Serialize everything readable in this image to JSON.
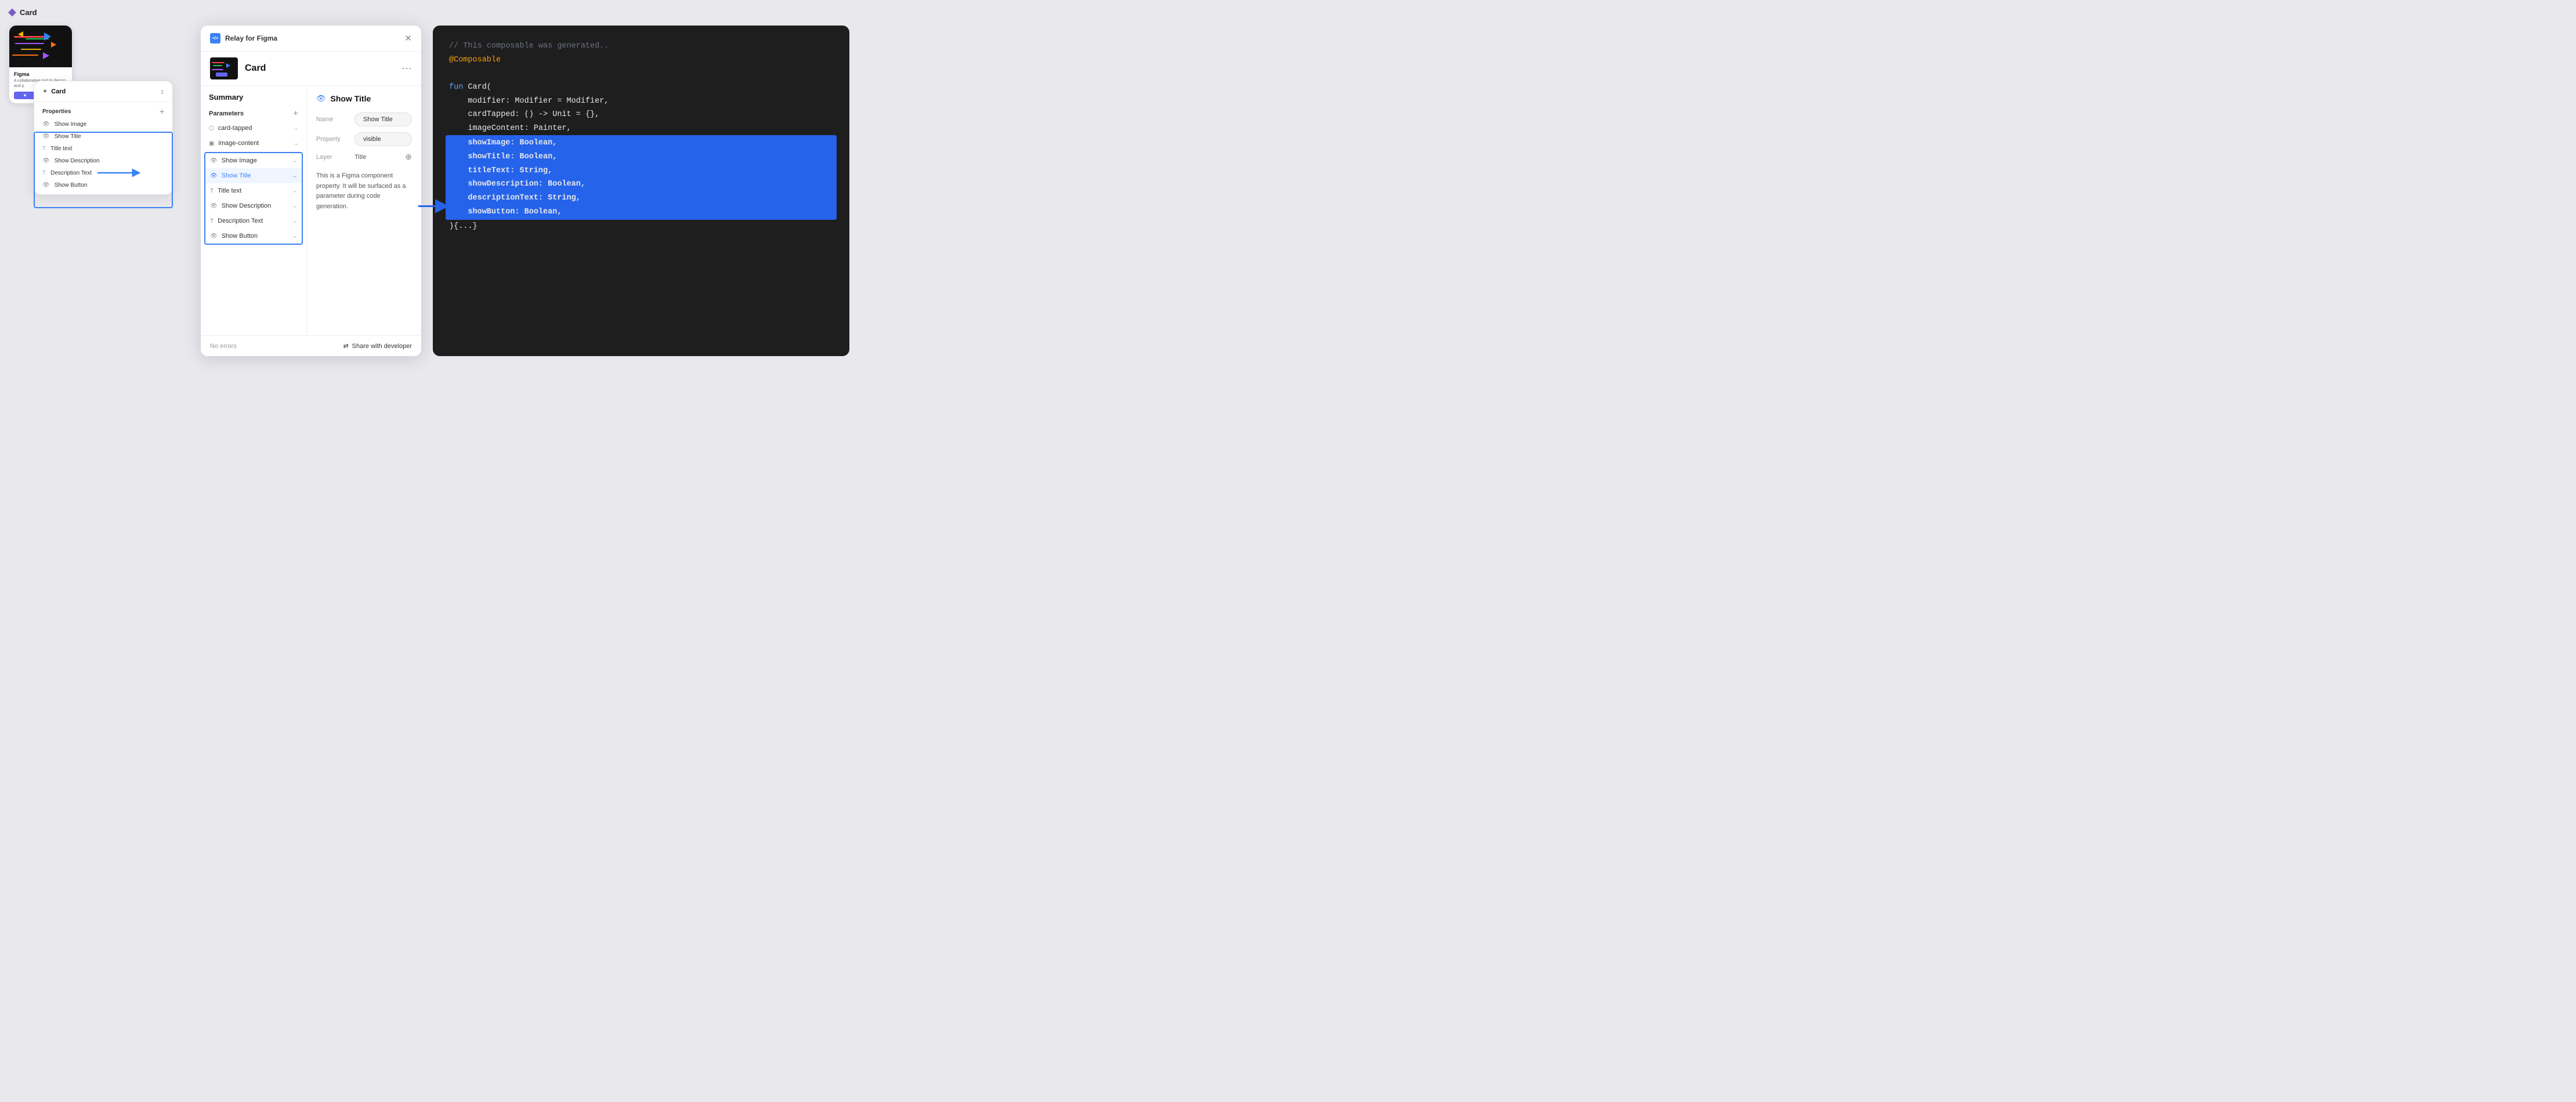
{
  "app": {
    "title": "Card"
  },
  "figmaCard": {
    "title": "Figma",
    "description": "A collaborative tool to design and p",
    "buttonLabel": "♥"
  },
  "propertiesPanel": {
    "title": "Card",
    "sectionLabel": "Properties",
    "items": [
      {
        "icon": "eye",
        "label": "Show Image"
      },
      {
        "icon": "eye",
        "label": "Show Title"
      },
      {
        "icon": "text",
        "label": "Title text"
      },
      {
        "icon": "eye",
        "label": "Show Description"
      },
      {
        "icon": "text",
        "label": "Description Text"
      },
      {
        "icon": "eye",
        "label": "Show Button"
      }
    ]
  },
  "relayPanel": {
    "header": {
      "logo": "</>",
      "title": "Relay for Figma",
      "closeLabel": "✕"
    },
    "component": {
      "name": "Card",
      "dotsLabel": "⋯"
    },
    "summary": {
      "label": "Summary",
      "params": {
        "label": "Parameters",
        "addLabel": "+",
        "items": [
          {
            "icon": "tap",
            "label": "card-tapped",
            "selected": false
          },
          {
            "icon": "img",
            "label": "image-content",
            "selected": false
          },
          {
            "icon": "eye",
            "label": "Show Image",
            "selected": false
          },
          {
            "icon": "eye",
            "label": "Show Title",
            "selected": true
          },
          {
            "icon": "text",
            "label": "Title text",
            "selected": false
          },
          {
            "icon": "eye",
            "label": "Show Description",
            "selected": false
          },
          {
            "icon": "text",
            "label": "Description Text",
            "selected": false
          },
          {
            "icon": "eye",
            "label": "Show Button",
            "selected": false
          }
        ]
      }
    },
    "detail": {
      "title": "Show Title",
      "fields": [
        {
          "label": "Name",
          "value": "Show Title"
        },
        {
          "label": "Property",
          "value": "visible"
        },
        {
          "label": "Layer",
          "value": "Title"
        }
      ],
      "description": "This is a Figma component property. It will be surfaced as a parameter during code generation."
    },
    "footer": {
      "noErrors": "No errors",
      "shareLabel": "Share with developer",
      "shareIcon": "⇄"
    }
  },
  "codePanel": {
    "lines": [
      {
        "text": "// This composable was generated..",
        "color": "gray"
      },
      {
        "text": "@Composable",
        "color": "orange"
      },
      {
        "text": "fun Card(",
        "color": "white",
        "funKeyword": "fun ",
        "nameKeyword": "Card"
      },
      {
        "text": "    modifier: Modifier = Modifier,",
        "color": "white"
      },
      {
        "text": "    cardTapped: () -> Unit = {},",
        "color": "white"
      },
      {
        "text": "    imageContent: Painter,",
        "color": "white"
      },
      {
        "text": "    showImage: Boolean,",
        "color": "white",
        "highlight": true
      },
      {
        "text": "    showTitle: Boolean,",
        "color": "white",
        "highlight": true
      },
      {
        "text": "    titleText: String,",
        "color": "white",
        "highlight": true
      },
      {
        "text": "    showDescription: Boolean,",
        "color": "white",
        "highlight": true
      },
      {
        "text": "    descriptionText: String,",
        "color": "white",
        "highlight": true
      },
      {
        "text": "    showButton: Boolean,",
        "color": "white",
        "highlight": true
      },
      {
        "text": "){...}",
        "color": "white"
      }
    ]
  }
}
